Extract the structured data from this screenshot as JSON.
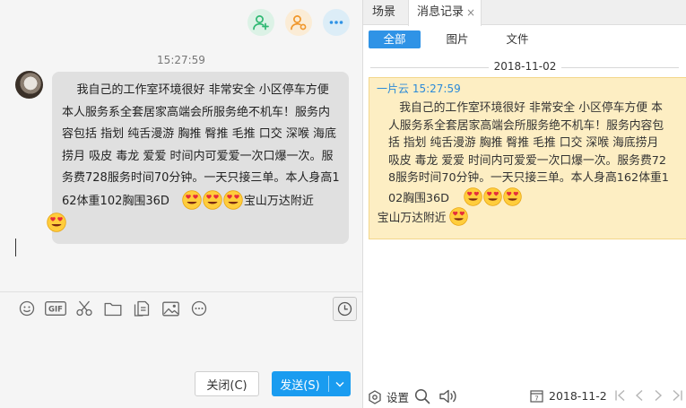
{
  "chat": {
    "message_time": "15:27:59",
    "message_text": "我自己的工作室环境很好 非常安全 小区停车方便 本人服务系全套居家高端会所服务绝不机车！服务内容包括 指划 纯舌漫游 胸推 臀推 毛推 口交 深喉 海底捞月 吸皮 毒龙 爱爱 时间内可爱爱一次口爆一次。服务费728服务时间70分钟。一天只接三单。本人身高162体重102胸围36D",
    "message_tail": "宝山万达附近",
    "emoji_icon": "heart-eyes-emoji"
  },
  "buttons": {
    "close": "关闭(C)",
    "send": "发送(S)"
  },
  "history": {
    "tabs": [
      "场景",
      "消息记录"
    ],
    "tab_close": "×",
    "filters": [
      "全部",
      "图片",
      "文件"
    ],
    "date_separator": "2018-11-02",
    "record_sender": "一片云",
    "record_time": "15:27:59",
    "record_text": "我自己的工作室环境很好 非常安全 小区停车方便 本人服务系全套居家高端会所服务绝不机车！服务内容包括 指划 纯舌漫游 胸推 臀推 毛推 口交 深喉 海底捞月 吸皮 毒龙 爱爱 时间内可爱爱一次口爆一次。服务费728服务时间70分钟。一天只接三单。本人身高162体重102胸围36D",
    "record_tail": "宝山万达附近",
    "settings_label": "设置",
    "current_date": "2018-11-2"
  },
  "colors": {
    "accent": "#1a9cf0",
    "bubble": "#e0e0e0",
    "record_bg": "#fdeec3",
    "sender_name": "#2b8ad8"
  }
}
